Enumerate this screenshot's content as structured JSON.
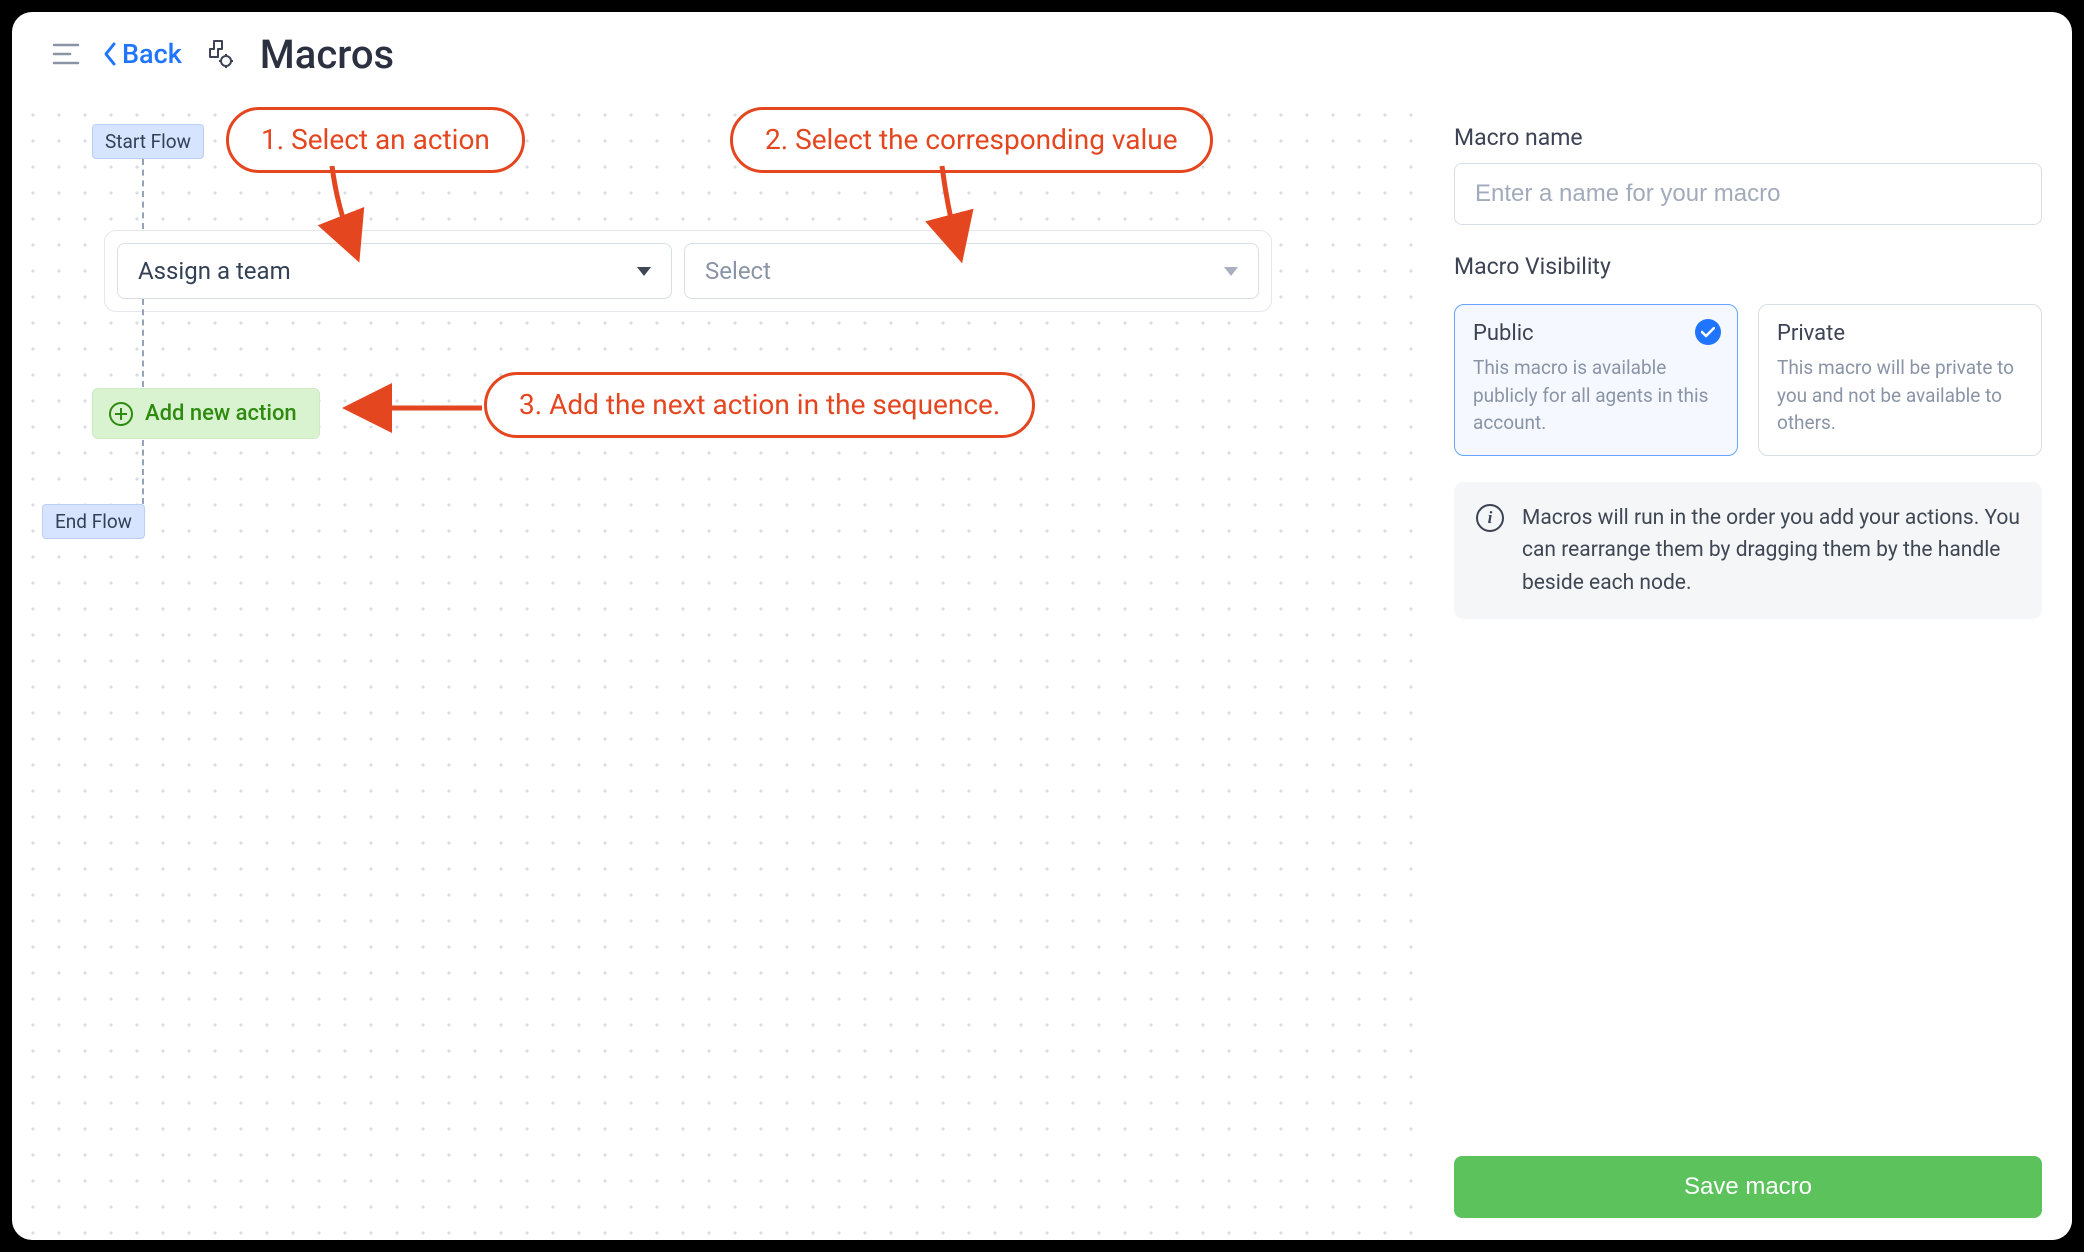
{
  "header": {
    "back_label": "Back",
    "title": "Macros"
  },
  "flow": {
    "start_label": "Start Flow",
    "end_label": "End Flow",
    "action_select_value": "Assign a team",
    "value_select_placeholder": "Select",
    "add_button_label": "Add new action"
  },
  "annotations": {
    "step1": "1. Select an action",
    "step2": "2. Select the corresponding value",
    "step3": "3. Add the next action in the sequence."
  },
  "sidebar": {
    "name_label": "Macro name",
    "name_placeholder": "Enter a name for your macro",
    "visibility_label": "Macro Visibility",
    "visibility": {
      "public": {
        "title": "Public",
        "desc": "This macro is available publicly for all agents in this account.",
        "selected": true
      },
      "private": {
        "title": "Private",
        "desc": "This macro will be private to you and not be available to others.",
        "selected": false
      }
    },
    "info": "Macros will run in the order you add your actions. You can rearrange them by dragging them by the handle beside each node.",
    "save_label": "Save macro"
  }
}
